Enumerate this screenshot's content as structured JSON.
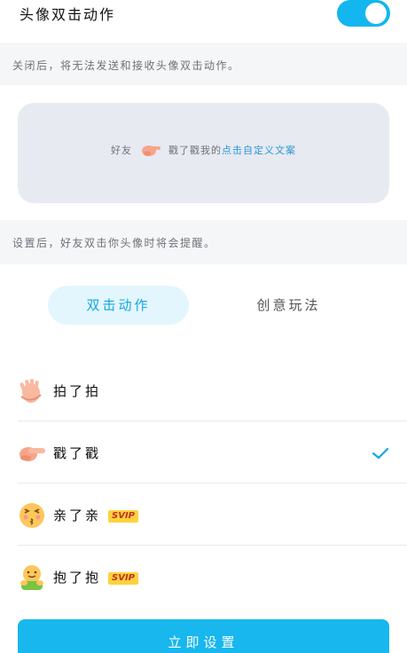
{
  "header": {
    "title": "头像双击动作",
    "toggle_on": true
  },
  "hints": {
    "toggle_hint": "关闭后，将无法发送和接收头像双击动作。",
    "settings_hint": "设置后，好友双击你头像时将会提醒。"
  },
  "preview": {
    "prefix": "好友",
    "action": "戳了戳我的",
    "link_text": "点击自定义文案"
  },
  "tabs": [
    {
      "label": "双击动作",
      "active": true
    },
    {
      "label": "创意玩法",
      "active": false
    }
  ],
  "actions": [
    {
      "label": "拍了拍",
      "icon": "clapping-hand-icon",
      "badge": "",
      "selected": false
    },
    {
      "label": "戳了戳",
      "icon": "pointing-finger-icon",
      "badge": "",
      "selected": true
    },
    {
      "label": "亲了亲",
      "icon": "kiss-face-icon",
      "badge": "SVIP",
      "selected": false
    },
    {
      "label": "抱了抱",
      "icon": "hug-emoji-icon",
      "badge": "SVIP",
      "selected": false
    }
  ],
  "footer": {
    "button_label": "立即设置"
  },
  "colors": {
    "accent": "#13b6ee",
    "tab_active_bg": "#e3f6fd",
    "svip_bg": "#ffd23e"
  }
}
